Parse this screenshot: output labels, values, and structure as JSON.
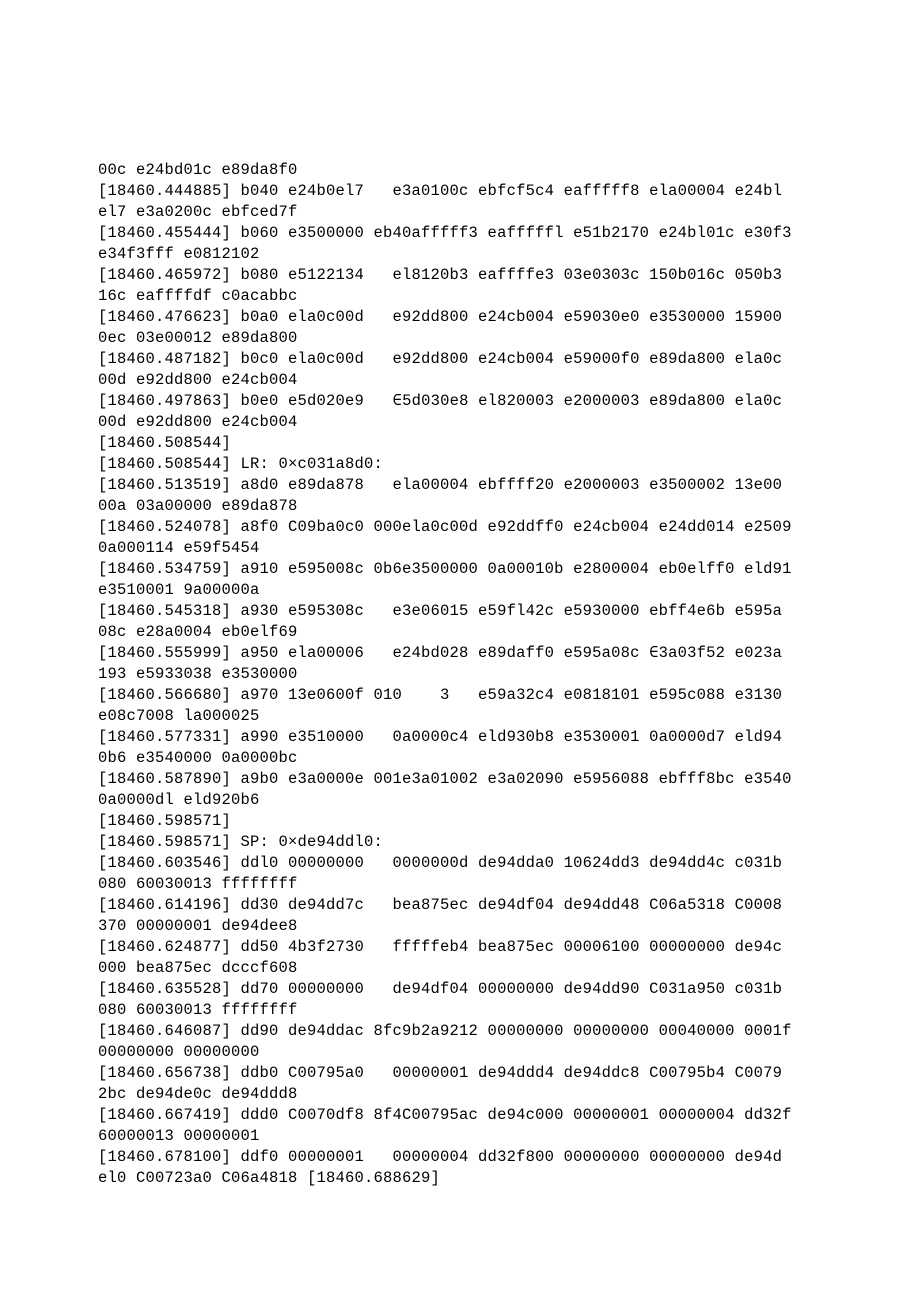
{
  "log_lines": [
    "00c e24bd01c e89da8f0",
    "[18460.444885] b040 e24b0el7   e3a0100c ebfcf5c4 eaffff​f8 ela00004 e24bl",
    "el7 e3a0200c ebfced7f",
    "[18460.455444] b060 e3500000 eb40afffff3 eafffffl e51b2170 e24bl01c e30f3",
    "e34f3fff e0812102",
    "[18460.465972] b080 e5122134   el8120b3 eaffffe3 03e0303c 150b016c 050b3",
    "16c eaffffdf c0acabbc",
    "[18460.476623] b0a0 ela0c00d   e92dd800 e24cb004 e59030e0 e3530000 15900",
    "0ec 03e00012 e89da800",
    "[18460.487182] b0c0 ela0c00d   e92dd800 e24cb004 e59000f0 e89da800 ela0c",
    "00d e92dd800 e24cb004",
    "[18460.497863] b0e0 e5d020e9   ∈5d030e8 el820003 e2000003 e89da800 ela0c",
    "00d e92dd800 e24cb004",
    "[18460.508544]",
    "[18460.508544] LR: 0×c031a8d0:",
    "[18460.513519] a8d0 e89da878   ela00004 ebffff20 e2000003 e3500002 13e00",
    "00a 03a00000 e89da878",
    "[18460.524078] a8f0 C09ba0c0 000ela0c00d e92ddff0 e24cb004 e24dd014 e2509",
    "0a000114 e59f5454",
    "[18460.534759] a910 e595008c 0b6e3500000 0a00010b e2800004 eb0elff0 eld91",
    "e3510001 9a00000a",
    "[18460.545318] a930 e595308c   e3e06015 e59fl42c e5930000 ebff4e6b e595a",
    "08c e28a0004 eb0elf69",
    "[18460.555999] a950 ela00006   e24bd028 e89daff0 e595a08c ∈3a03f52 e023a",
    "193 e5933038 e3530000",
    "[18460.566680] a970 13e0600f 010    3   e59a32c4 e0818101 e595c088 e3130",
    "e08c7008 la000025",
    "[18460.577331] a990 e3510000   0a0000c4 eld930b8 e3530001 0a0000d7 eld94",
    "0b6 e3540000 0a0000bc",
    "[18460.587890] a9b0 e3a0000e 001e3a01002 e3a02090 e5956088 ebfff8bc e3540",
    "0a0000dl eld920b6",
    "[18460.598571]",
    "[18460.598571] SP: 0×de94ddl0:",
    "[18460.603546] ddl0 00000000   0000000d de94dda0 10624dd3 de94dd4c c031b",
    "080 60030013 ffffffff",
    "[18460.614196] dd30 de94dd7c   bea875ec de94df04 de94dd48 C06a5318 C0008",
    "370 00000001 de94dee8",
    "[18460.624877] dd50 4b3f2730   fffffeb4 bea875ec 00006100 00000000 de94c",
    "000 bea875ec dcccf608",
    "[18460.635528] dd70 00000000   de94df04 00000000 de94dd90 C031a950 c031b",
    "080 60030013 ffffffff",
    "[18460.646087] dd90 de94ddac 8fc9b2a9212 00000000 00000000 00040000 0001f",
    "00000000 00000000",
    "[18460.656738] ddb0 C00795a0   00000001 de94ddd4 de94ddc8 C00795b4 C0079",
    "2bc de94de0c de94ddd8",
    "[18460.667419] ddd0 C0070df8 8f4C00795ac de94c000 00000001 00000004 dd32f",
    "60000013 00000001",
    "[18460.678100] ddf0 00000001   00000004 dd32f800 00000000 00000000 de94d",
    "el0 C00723a0 C06a4818 [18460.688629]"
  ]
}
